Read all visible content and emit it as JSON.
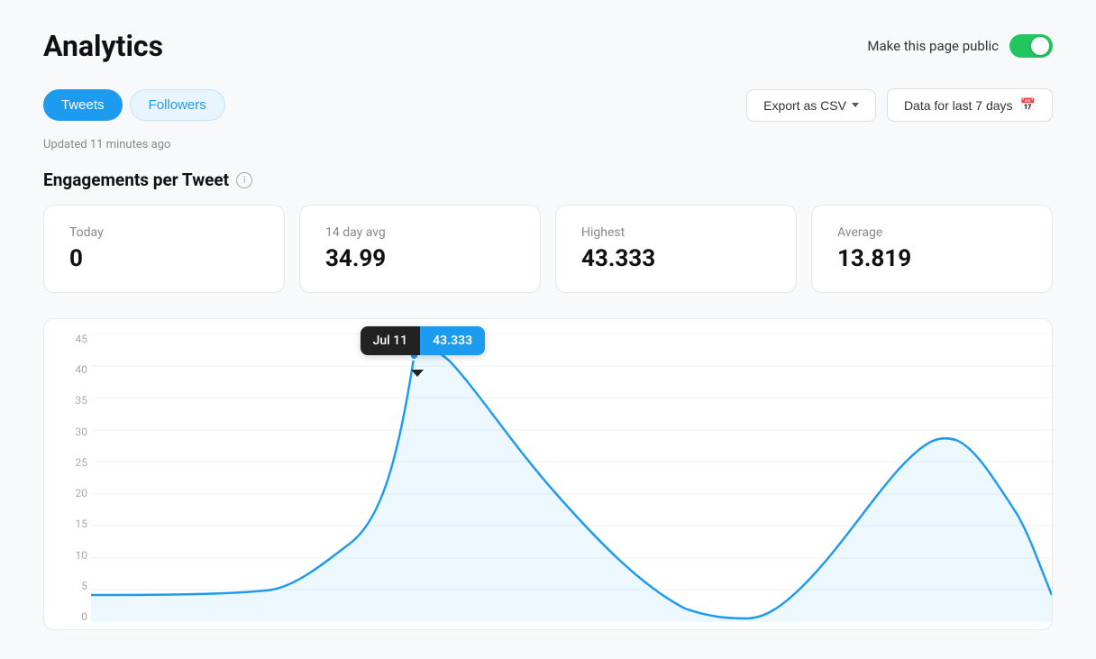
{
  "page": {
    "title": "Analytics",
    "public_toggle_label": "Make this page public",
    "toggle_on": true
  },
  "tabs": [
    {
      "id": "tweets",
      "label": "Tweets",
      "active": true
    },
    {
      "id": "followers",
      "label": "Followers",
      "active": false
    }
  ],
  "controls": {
    "export_label": "Export as CSV",
    "date_range_label": "Data for last 7 days"
  },
  "updated": {
    "text": "Updated 11 minutes ago"
  },
  "section": {
    "title": "Engagements per Tweet"
  },
  "stats": [
    {
      "id": "today",
      "label": "Today",
      "value": "0"
    },
    {
      "id": "14day",
      "label": "14 day avg",
      "value": "34.99"
    },
    {
      "id": "highest",
      "label": "Highest",
      "value": "43.333"
    },
    {
      "id": "average",
      "label": "Average",
      "value": "13.819"
    }
  ],
  "chart": {
    "y_labels": [
      "0",
      "5",
      "10",
      "15",
      "20",
      "25",
      "30",
      "35",
      "40",
      "45"
    ],
    "tooltip": {
      "date": "Jul 11",
      "value": "43.333"
    }
  }
}
